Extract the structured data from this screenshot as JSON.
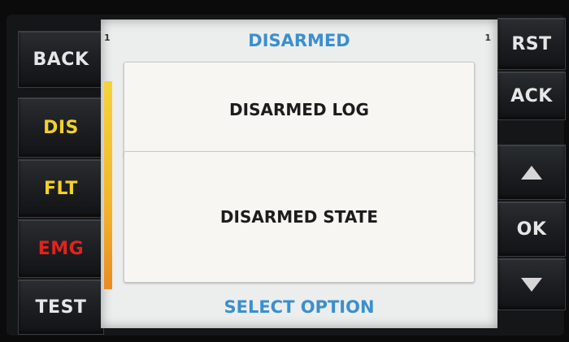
{
  "left_keys": [
    {
      "label": "BACK",
      "color": "#e6e6e6"
    },
    {
      "label": "DIS",
      "color": "#f2d12a"
    },
    {
      "label": "FLT",
      "color": "#f2d12a"
    },
    {
      "label": "EMG",
      "color": "#e0231f"
    },
    {
      "label": "TEST",
      "color": "#e6e6e6"
    }
  ],
  "right_keys": [
    {
      "label": "RST",
      "color": "#e6e6e6"
    },
    {
      "label": "ACK",
      "color": "#e6e6e6"
    },
    {
      "label": "",
      "icon": "up-arrow-icon",
      "color": "#d6d6d6"
    },
    {
      "label": "OK",
      "color": "#e6e6e6"
    },
    {
      "label": "",
      "icon": "down-arrow-icon",
      "color": "#d6d6d6"
    }
  ],
  "screen": {
    "title": "DISARMED",
    "page_left": "1",
    "page_right": "1",
    "options": [
      "DISARMED LOG",
      "DISARMED STATE"
    ],
    "footer": "SELECT OPTION",
    "accent_color": "#3b8fcf",
    "scroll_indicator_colors": [
      "#f6d33a",
      "#e98b23"
    ]
  }
}
